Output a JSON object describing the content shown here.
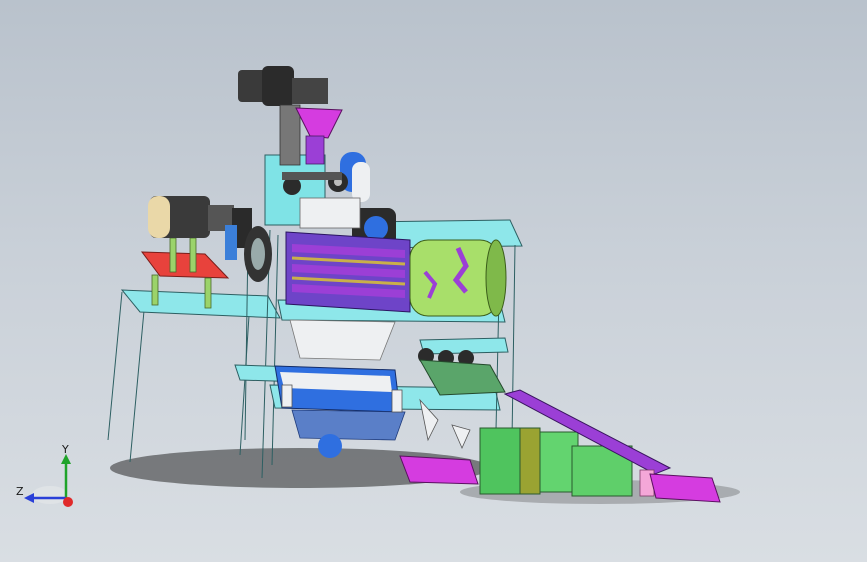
{
  "viewport": {
    "background_top": "#b9c2cc",
    "background_bottom": "#d9dee3"
  },
  "colors": {
    "frame": "#7fe3e6",
    "frame_edge": "#2d5f62",
    "purple": "#9b3fd6",
    "magenta": "#d53ce0",
    "green": "#63d46f",
    "olive": "#9aa332",
    "blue": "#2f6fe0",
    "red": "#e8423c",
    "steel": "#b8c0c8",
    "dark": "#2b2b2b"
  },
  "triad": {
    "x_label": "",
    "y_label": "Y",
    "z_label": "Z"
  }
}
